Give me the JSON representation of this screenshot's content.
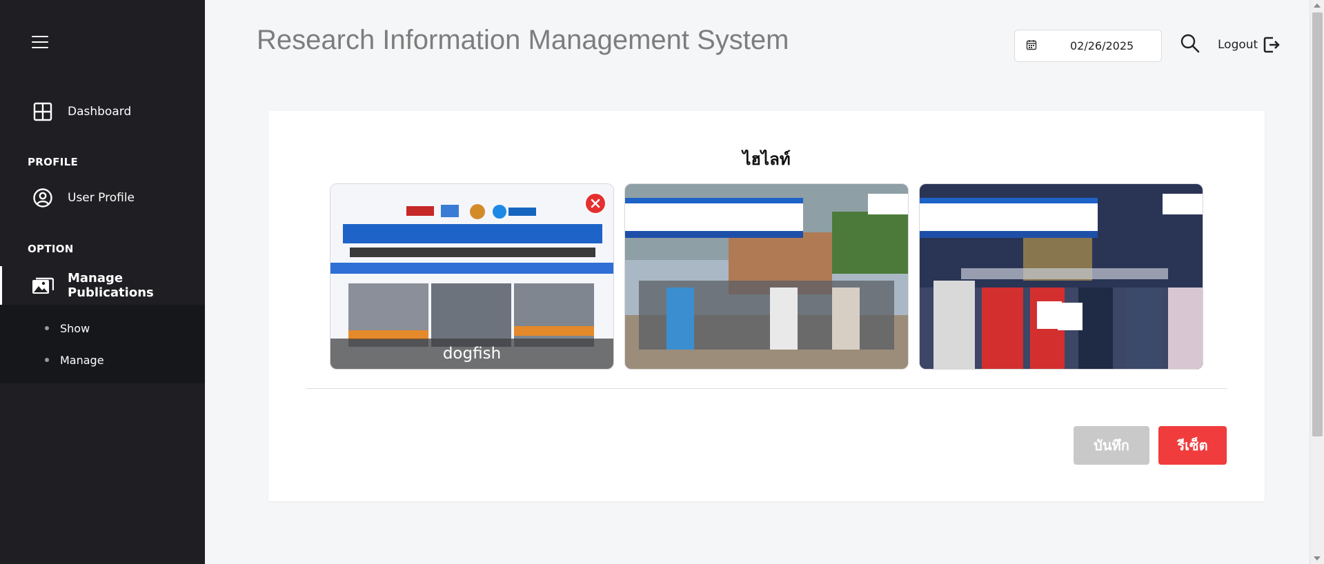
{
  "sidebar": {
    "menu_icon": "hamburger-icon",
    "dashboard": {
      "label": "Dashboard",
      "icon": "grid-icon"
    },
    "profile_section": "PROFILE",
    "user_profile": {
      "label": "User Profile",
      "icon": "user-circle-icon"
    },
    "option_section": "OPTION",
    "manage_publications": {
      "label": "Manage Publications",
      "icon": "images-icon"
    },
    "sub_items": [
      {
        "label": "Show"
      },
      {
        "label": "Manage"
      }
    ]
  },
  "header": {
    "title": "Research Information Management System",
    "date": "02/26/2025",
    "date_icon": "calendar-icon",
    "search_icon": "search-icon",
    "logout_label": "Logout",
    "logout_icon": "logout-icon"
  },
  "highlight": {
    "title": "ไฮไลท์",
    "items": [
      {
        "caption": "dogfish",
        "removable": true
      },
      {
        "caption": ""
      },
      {
        "caption": ""
      }
    ],
    "save_label": "บันทึก",
    "reset_label": "รีเซ็ต"
  },
  "colors": {
    "sidebar_bg": "#1f1f23",
    "reset_button": "#f03c3c",
    "save_button_disabled": "#c9c9c9",
    "close_button": "#e53030"
  }
}
